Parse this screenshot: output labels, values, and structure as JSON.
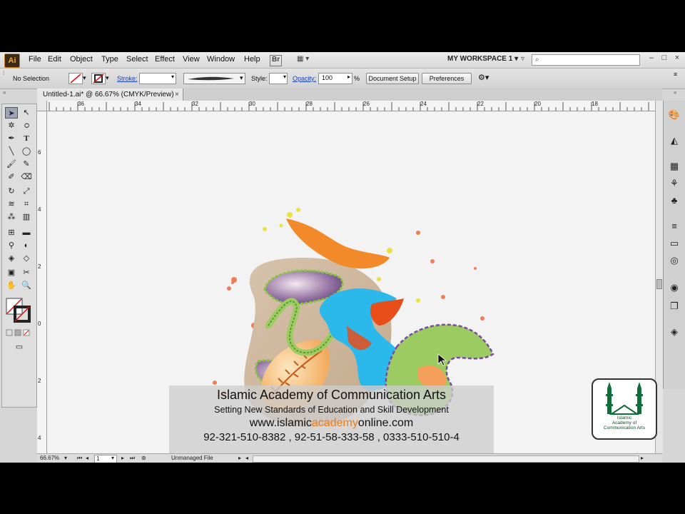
{
  "menu": {
    "app_logo": "Ai",
    "items": [
      "File",
      "Edit",
      "Object",
      "Type",
      "Select",
      "Effect",
      "View",
      "Window",
      "Help"
    ],
    "bridge_label": "Br",
    "workspace": "MY WORKSPACE 1"
  },
  "control_bar": {
    "selection": "No Selection",
    "stroke_label": "Stroke:",
    "style_label": "Style:",
    "opacity_label": "Opacity:",
    "opacity_value": "100",
    "opacity_unit": "%",
    "document_setup": "Document Setup",
    "preferences": "Preferences"
  },
  "tab": {
    "title": "Untitled-1.ai* @ 66.67% (CMYK/Preview)",
    "close": "×"
  },
  "ruler": {
    "horizontal": [
      "36",
      "34",
      "32",
      "30",
      "28",
      "26",
      "24",
      "22",
      "20",
      "18"
    ],
    "vertical": [
      "6",
      "4",
      "2",
      "0",
      "2",
      "4"
    ]
  },
  "status": {
    "zoom": "66.67%",
    "page": "1",
    "file_status": "Unmanaged File"
  },
  "watermark": {
    "title": "Islamic Academy of Communication Arts",
    "tagline": "Setting New Standards of Education and Skill Development",
    "url_pre": "www.islamic",
    "url_mid": "academy",
    "url_post": "online.com",
    "phones": "92-321-510-8382  ,  92-51-58-333-58 , 0333-510-510-4"
  },
  "logo": {
    "line1": "Islamic",
    "line2": "Academy of",
    "line3": "Communication Arts"
  },
  "colors": {
    "accent_blue": "#2bb8ea",
    "accent_orange": "#f07c1a",
    "accent_green": "#9ccb62",
    "accent_purple": "#8a6a9e",
    "brand_green": "#0f6e3a"
  },
  "icons": [
    "selection-tool-icon",
    "direct-selection-icon",
    "magic-wand-icon",
    "lasso-icon",
    "pen-icon",
    "type-icon",
    "line-icon",
    "ellipse-icon",
    "paintbrush-icon",
    "pencil-icon",
    "blob-brush-icon",
    "eraser-icon",
    "rotate-icon",
    "scale-icon",
    "warp-icon",
    "free-transform-icon",
    "symbol-sprayer-icon",
    "graph-icon",
    "mesh-icon",
    "gradient-icon",
    "eyedropper-icon",
    "blend-icon",
    "live-paint-icon",
    "live-paint-select-icon",
    "artboard-icon",
    "slice-icon",
    "hand-icon",
    "zoom-icon"
  ]
}
